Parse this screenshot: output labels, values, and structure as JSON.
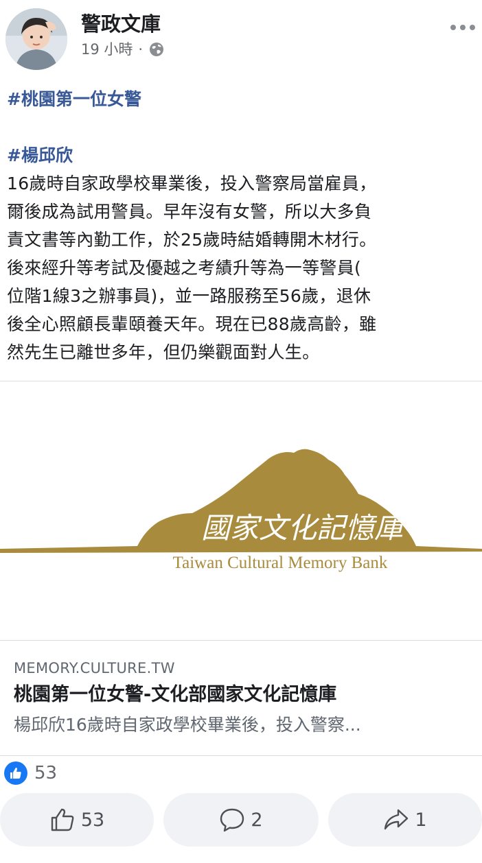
{
  "post": {
    "page_name": "警政文庫",
    "time": "19 小時",
    "separator": "·",
    "hashtag1": "#桃園第一位女警",
    "hashtag2": "#楊邱欣",
    "text_lines": [
      "16歲時自家政學校畢業後，投入警察局當雇員，",
      "爾後成為試用警員。早年沒有女警，所以大多負",
      "責文書等內勤工作，於25歲時結婚轉開木材行。",
      "後來經升等考試及優越之考績升等為一等警員(",
      "位階1線3之辦事員)，並一路服務至56歲，退休",
      "後全心照顧長輩頤養天年。現在已88歲高齡，雖",
      "然先生已離世多年，但仍樂觀面對人生。"
    ]
  },
  "link_preview": {
    "logo_chinese": "國家文化記憶庫",
    "logo_english": "Taiwan Cultural Memory Bank",
    "domain": "MEMORY.CULTURE.TW",
    "title": "桃園第一位女警-文化部國家文化記憶庫",
    "description": "楊邱欣16歲時自家政學校畢業後，投入警察..."
  },
  "reactions": {
    "count": "53"
  },
  "actions": {
    "like_count": "53",
    "comment_count": "2",
    "share_count": "1"
  },
  "colors": {
    "logo_gold": "#a88b3c",
    "like_blue": "#1877f2",
    "hashtag": "#385898"
  }
}
